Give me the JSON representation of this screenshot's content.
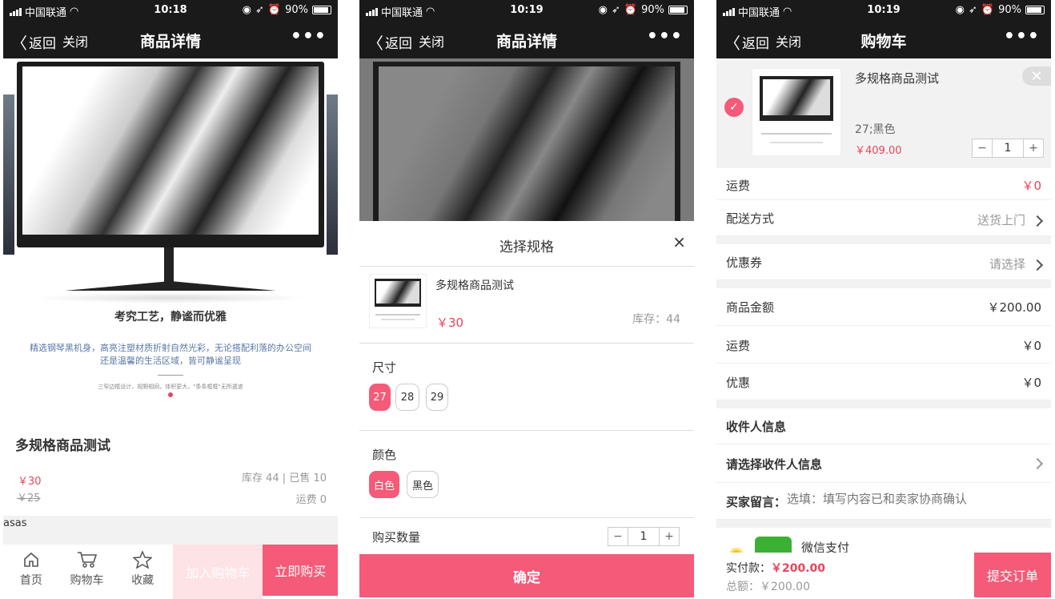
{
  "statusbar": {
    "carrier": "中国联通",
    "time": "10:18",
    "time2": "10:19",
    "battery": "90%"
  },
  "nav": {
    "back": "返回",
    "close": "关闭",
    "more": "•••",
    "detail_title": "商品详情",
    "cart_title": "购物车"
  },
  "p1": {
    "hero_heading": "考究工艺，静谧而优雅",
    "hero_text1": "精选钢琴黑机身，高亮注塑材质折射自然光彩，无论搭配利落的办公空间",
    "hero_text2": "还是温馨的生活区域，皆可静谧呈现",
    "hero_small": "三窄边框设计，视野相同，体积更大，\"条条框框\"无所遁迹",
    "name": "多规格商品测试",
    "price": "￥30",
    "old_price": "￥25",
    "stock": "库存 44 | 已售 10",
    "shipping": "运费 0",
    "desc": "asas",
    "tabs": {
      "home": "首页",
      "cart": "购物车",
      "fav": "收藏"
    },
    "add_cart": "加入购物车",
    "buy_now": "立即购买"
  },
  "p2": {
    "sheet_title": "选择规格",
    "close": "×",
    "name": "多规格商品测试",
    "price": "￥30",
    "stock": "库存：44",
    "size_label": "尺寸",
    "sizes": [
      "27",
      "28",
      "29"
    ],
    "color_label": "颜色",
    "colors": [
      "白色",
      "黑色"
    ],
    "qty_label": "购买数量",
    "qty": "1",
    "minus": "−",
    "plus": "+",
    "confirm": "确定"
  },
  "p3": {
    "item_name": "多规格商品测试",
    "item_spec": "27;黑色",
    "item_price": "￥409.00",
    "item_qty": "1",
    "delete": "✕",
    "check": "✓",
    "shipping_k": "运费",
    "shipping_v": "￥0",
    "delivery_k": "配送方式",
    "delivery_v": "送货上门",
    "coupon_k": "优惠券",
    "coupon_v": "请选择",
    "amount_k": "商品金额",
    "amount_v": "￥200.00",
    "freight_k": "运费",
    "freight_v": "￥0",
    "discount_k": "优惠",
    "discount_v": "￥0",
    "receiver_title": "收件人信息",
    "receiver_select": "请选择收件人信息",
    "note_k": "买家留言：",
    "note_placeholder": "选填：填写内容已和卖家协商确认",
    "wechat": "微信支付",
    "pay_label": "实付款：",
    "pay_value": "￥200.00",
    "total_label": "总额：",
    "total_value": "￥200.00",
    "submit": "提交订单"
  },
  "colors": {
    "accent": "#f55a78",
    "price": "#e8445a",
    "navbar": "#1a1a1a"
  }
}
